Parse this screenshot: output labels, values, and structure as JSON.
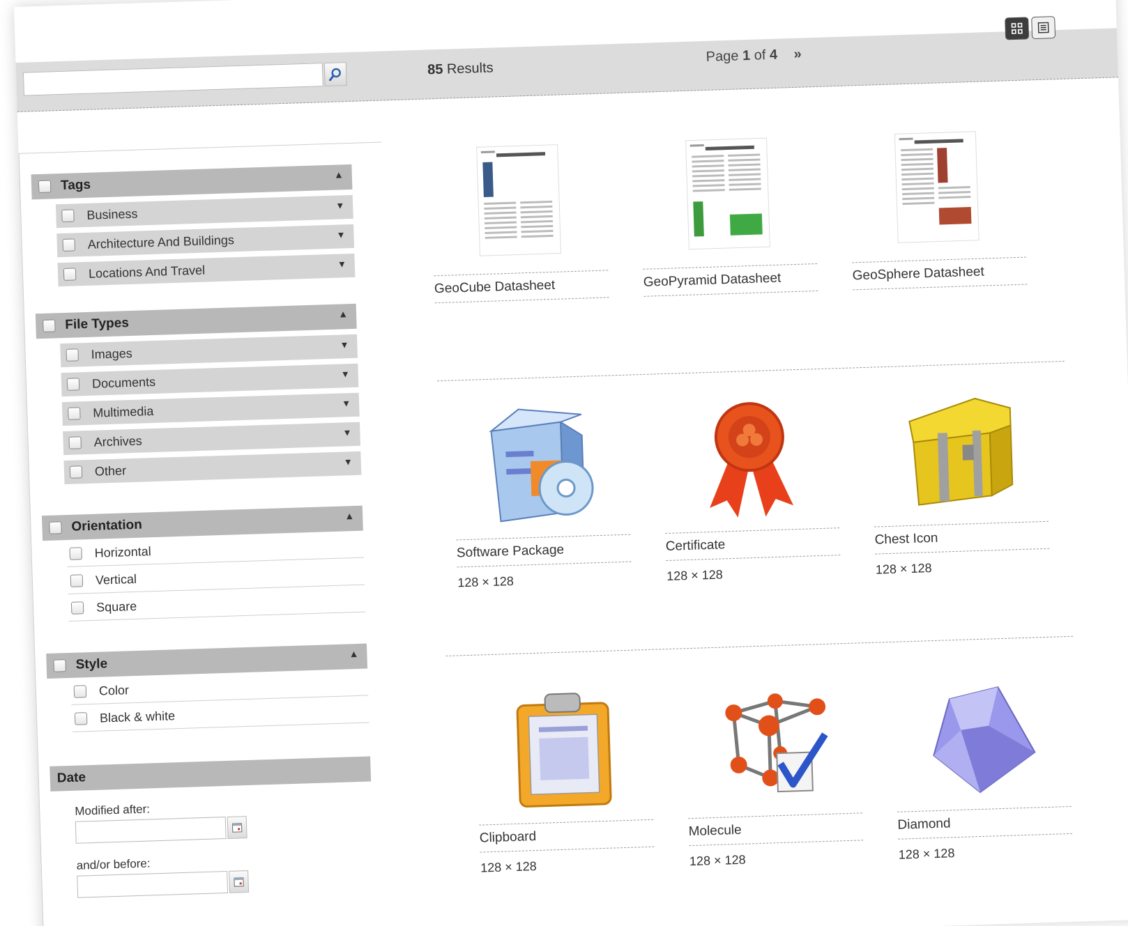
{
  "search": {
    "value": "",
    "placeholder": ""
  },
  "header": {
    "results_count": "85",
    "results_label": "Results",
    "page_prefix": "Page",
    "page_current": "1",
    "page_of": "of",
    "page_total": "4",
    "next_label": "»"
  },
  "view_toggle": {
    "grid_icon": "grid-icon",
    "list_icon": "list-icon"
  },
  "filters": {
    "tags": {
      "title": "Tags",
      "items": [
        "Business",
        "Architecture And Buildings",
        "Locations And Travel"
      ]
    },
    "file_types": {
      "title": "File Types",
      "items": [
        "Images",
        "Documents",
        "Multimedia",
        "Archives",
        "Other"
      ]
    },
    "orientation": {
      "title": "Orientation",
      "items": [
        "Horizontal",
        "Vertical",
        "Square"
      ]
    },
    "style": {
      "title": "Style",
      "items": [
        "Color",
        "Black & white"
      ]
    },
    "date": {
      "title": "Date",
      "after_label": "Modified after:",
      "before_label": "and/or before:"
    }
  },
  "items": [
    {
      "name": "GeoCube Datasheet",
      "size": "",
      "icon": "document-icon"
    },
    {
      "name": "GeoPyramid Datasheet",
      "size": "",
      "icon": "document-icon"
    },
    {
      "name": "GeoSphere Datasheet",
      "size": "",
      "icon": "document-icon"
    },
    {
      "name": "Software Package",
      "size": "128 × 128",
      "icon": "software-package-icon"
    },
    {
      "name": "Certificate",
      "size": "128 × 128",
      "icon": "certificate-icon"
    },
    {
      "name": "Chest Icon",
      "size": "128 × 128",
      "icon": "chest-icon"
    },
    {
      "name": "Clipboard",
      "size": "128 × 128",
      "icon": "clipboard-icon"
    },
    {
      "name": "Molecule",
      "size": "128 × 128",
      "icon": "molecule-icon"
    },
    {
      "name": "Diamond",
      "size": "128 × 128",
      "icon": "diamond-icon"
    }
  ],
  "colors": {
    "header_bg": "#dcdcdc",
    "group_head": "#b8b8b8",
    "sub_item": "#d4d4d4"
  }
}
